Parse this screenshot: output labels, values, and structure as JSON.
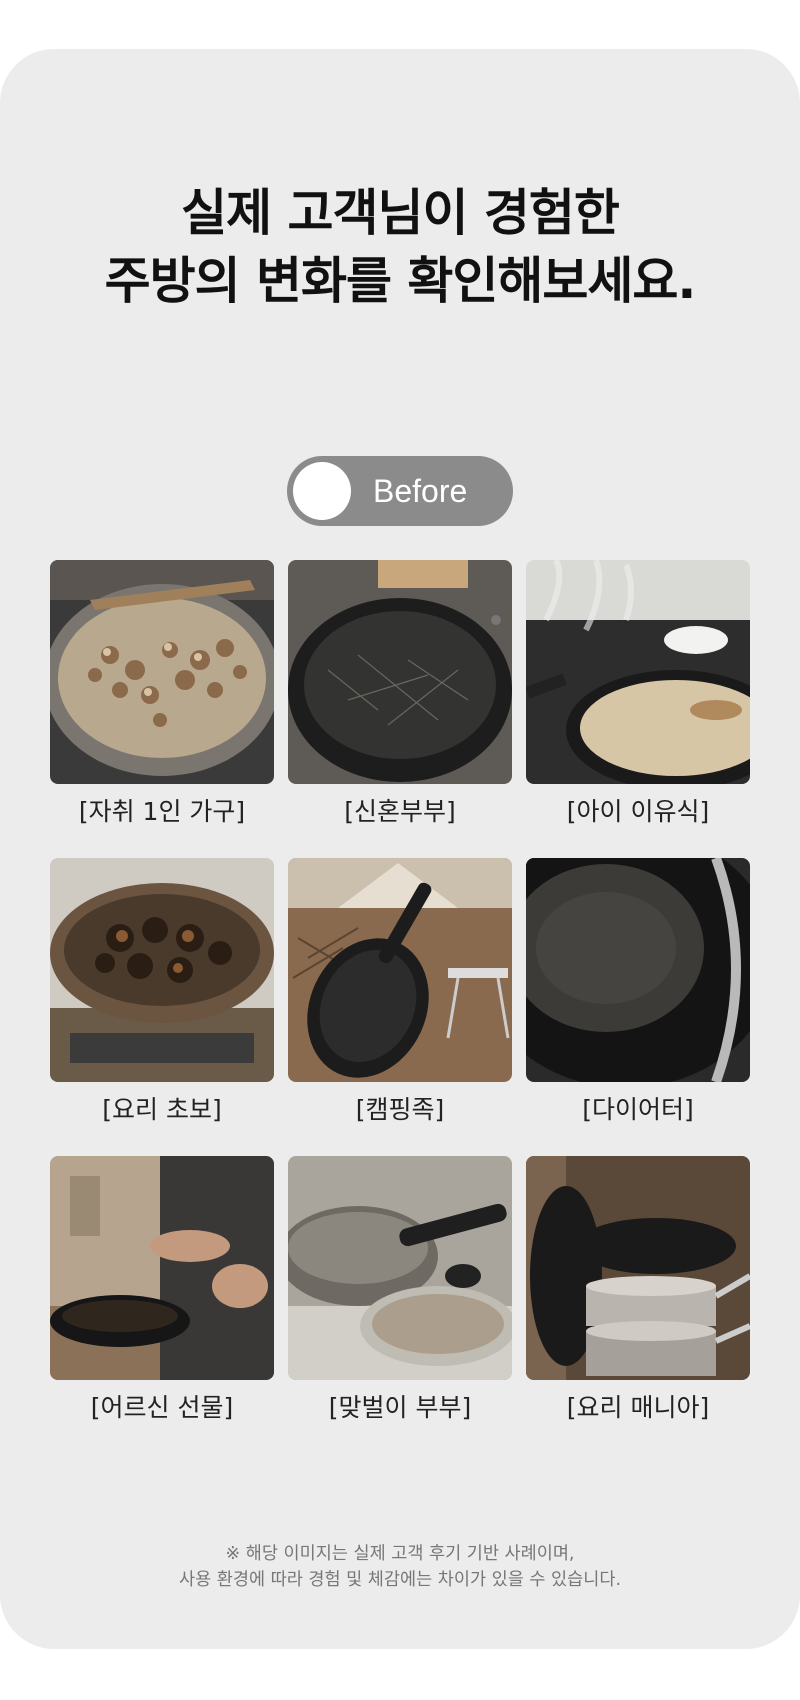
{
  "headline": {
    "line1": "실제 고객님이 경험한",
    "line2": "주방의 변화를 확인해보세요."
  },
  "toggle": {
    "label": "Before",
    "state": "before"
  },
  "cases": [
    {
      "caption": "[자취 1인 가구]"
    },
    {
      "caption": "[신혼부부]"
    },
    {
      "caption": "[아이 이유식]"
    },
    {
      "caption": "[요리 초보]"
    },
    {
      "caption": "[캠핑족]"
    },
    {
      "caption": "[다이어터]"
    },
    {
      "caption": "[어르신 선물]"
    },
    {
      "caption": "[맞벌이 부부]"
    },
    {
      "caption": "[요리 매니아]"
    }
  ],
  "notice": {
    "line1": "※ 해당 이미지는 실제 고객 후기 기반 사례이며,",
    "line2": "사용 환경에 따라 경험 및 체감에는 차이가 있을 수 있습니다."
  },
  "colors": {
    "card": "#ececec",
    "toggle": "#8b8b8b",
    "text": "#111111"
  }
}
